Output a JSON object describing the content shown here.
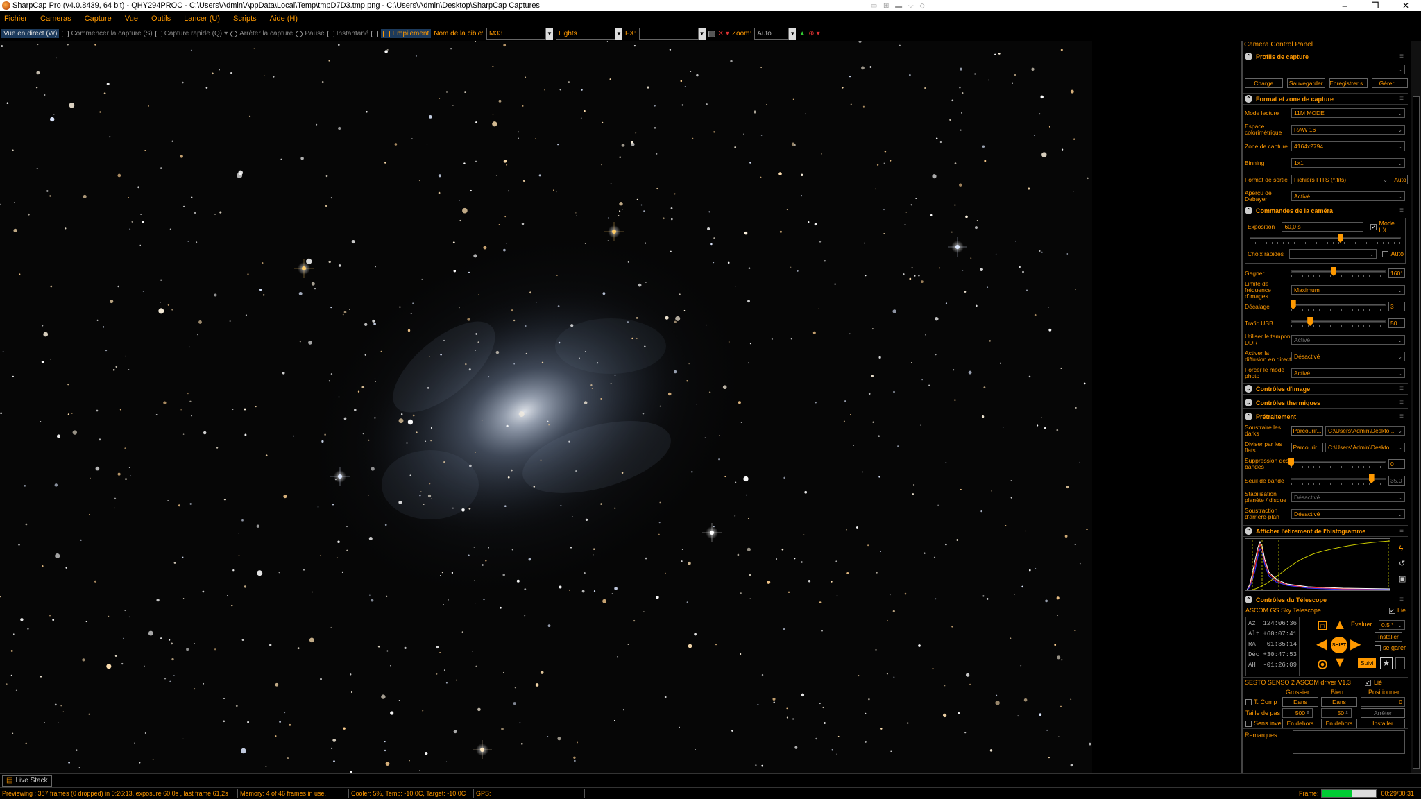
{
  "window": {
    "title": "SharpCap Pro (v4.0.8439, 64 bit) - QHY294PROC - C:\\Users\\Admin\\AppData\\Local\\Temp\\tmpD7D3.tmp.png - C:\\Users\\Admin\\Desktop\\SharpCap Captures",
    "controls": [
      "–",
      "❐",
      "✕"
    ]
  },
  "menu": [
    "Fichier",
    "Cameras",
    "Capture",
    "Vue",
    "Outils",
    "Lancer (U)",
    "Scripts",
    "Aide (H)"
  ],
  "toolbar": {
    "live_view": "Vue en direct (W)",
    "start_capture": "Commencer la capture (S)",
    "quick_capture": "Capture rapide (Q)",
    "stop_capture": "Arrêter la capture",
    "pause": "Pause",
    "snapshot": "Instantané",
    "stacking": "Empilement",
    "target_label": "Nom de la cible:",
    "target_value": "M33",
    "frame_type": "Lights",
    "fx_label": "FX:",
    "fx_value": "",
    "zoom_label": "Zoom:",
    "zoom_value": "Auto"
  },
  "panel": {
    "title": "Camera Control Panel",
    "capture_profiles": {
      "header": "Profils de capture",
      "selected": "",
      "buttons": [
        "Charge",
        "Sauvegarder",
        "Enregistrer s...",
        "Gérer ..."
      ]
    },
    "format": {
      "header": "Format et zone de capture",
      "rows": [
        {
          "label": "Mode lecture",
          "value": "11M MODE"
        },
        {
          "label": "Espace colorimétrique",
          "value": "RAW 16"
        },
        {
          "label": "Zone de capture",
          "value": "4164x2794"
        },
        {
          "label": "Binning",
          "value": "1x1"
        },
        {
          "label": "Format de sortie",
          "value": "Fichiers FITS (*.fits)",
          "extra": "Auto"
        },
        {
          "label": "Aperçu de Debayer",
          "value": "Activé"
        }
      ]
    },
    "camera": {
      "header": "Commandes de la caméra",
      "exposure_label": "Exposition",
      "exposure_value": "60,0 s",
      "lx_mode": "Mode LX",
      "exposure_slider": 0.6,
      "quick_label": "Choix rapides",
      "quick_auto": "Auto",
      "gain_label": "Gagner",
      "gain_value": "1601",
      "gain_slider": 0.45,
      "fps_label": "Limite de fréquence d'images",
      "fps_value": "Maximum",
      "offset_label": "Décalage",
      "offset_value": "3",
      "offset_slider": 0.02,
      "usb_label": "Trafic USB",
      "usb_value": "50",
      "usb_slider": 0.2,
      "ddr_label": "Utiliser le tampon DDR",
      "ddr_value": "Activé",
      "stream_label": "Activer la diffusion en direct",
      "stream_value": "Désactivé",
      "photo_label": "Forcer le mode photo",
      "photo_value": "Activé"
    },
    "image_controls": {
      "header": "Contrôles d'image"
    },
    "thermal": {
      "header": "Contrôles thermiques"
    },
    "preprocessing": {
      "header": "Prétraitement",
      "darks_label": "Soustraire les darks",
      "darks_browse": "Parcourir...",
      "darks_path": "C:\\Users\\Admin\\Deskto...",
      "flats_label": "Diviser par les flats",
      "flats_browse": "Parcourir...",
      "flats_path": "C:\\Users\\Admin\\Deskto...",
      "banding_label": "Suppression des bandes",
      "banding_value": "0",
      "banding_slider": 0.0,
      "threshold_label": "Seuil de bande",
      "threshold_value": "35,0",
      "threshold_slider": 0.85,
      "stab_label": "Stabilisation planète / disque",
      "stab_value": "Désactivé",
      "bg_label": "Soustraction d'arrière-plan",
      "bg_value": "Désactivé"
    },
    "histogram": {
      "header": "Afficher l'étirement de l'histogramme"
    },
    "telescope": {
      "header": "Contrôles du Télescope",
      "name": "ASCOM GS Sky Telescope",
      "connected": "Lié",
      "az_label": "Az",
      "az": "124:06:36",
      "alt_label": "Alt",
      "alt": "+60:07:41",
      "ra_label": "RA",
      "ra": "01:35:14",
      "dec_label": "Déc",
      "dec": "+30:47:53",
      "ah_label": "AH",
      "ah": "-01:26:09",
      "rate_label": "Évaluer",
      "rate_value": "0.5 °",
      "install": "Installer",
      "park": "se garer",
      "follow": "Suivi",
      "center_label": "SHIFT"
    },
    "focuser": {
      "name": "SESTO SENSO 2 ASCOM driver V1.3",
      "connected": "Lié",
      "col_coarse": "Grossier",
      "col_fine": "Bien",
      "col_position": "Positionner",
      "tcomp": "T. Comp",
      "in_label": "Dans",
      "position_value": "0",
      "step_label": "Taille de pas",
      "step_coarse": "500",
      "step_fine": "50",
      "stop": "Arrêter",
      "reverse": "Sens inve",
      "out_label": "En dehors",
      "install": "Installer"
    },
    "notes_label": "Remarques"
  },
  "status": {
    "live_stack_tab": "Live Stack",
    "preview": "Previewing : 387 frames (0 dropped) in 0:26:13, exposure 60,0s , last frame 61,2s",
    "memory": "Memory: 4 of 46 frames in use.",
    "cooler": "Cooler: 5%, Temp: -10,0C, Target: -10,0C",
    "gps": "GPS:",
    "frame_label": "Frame:",
    "frame_progress": 0.55,
    "time": "00:29/00:31"
  },
  "colors": {
    "accent": "#ff9900",
    "progress": "#00cc33"
  }
}
